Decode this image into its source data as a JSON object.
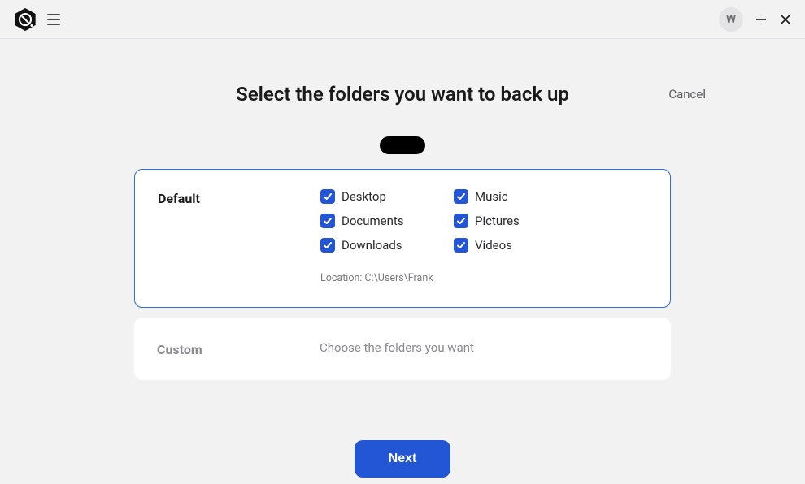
{
  "avatar_letter": "W",
  "page_title": "Select the folders you want to back up",
  "cancel_label": "Cancel",
  "default_card": {
    "label": "Default",
    "folders": {
      "desktop": "Desktop",
      "documents": "Documents",
      "downloads": "Downloads",
      "music": "Music",
      "pictures": "Pictures",
      "videos": "Videos"
    },
    "location_prefix": "Location: ",
    "location_path": "C:\\Users\\Frank"
  },
  "custom_card": {
    "label": "Custom",
    "hint": "Choose the folders you want"
  },
  "next_label": "Next"
}
